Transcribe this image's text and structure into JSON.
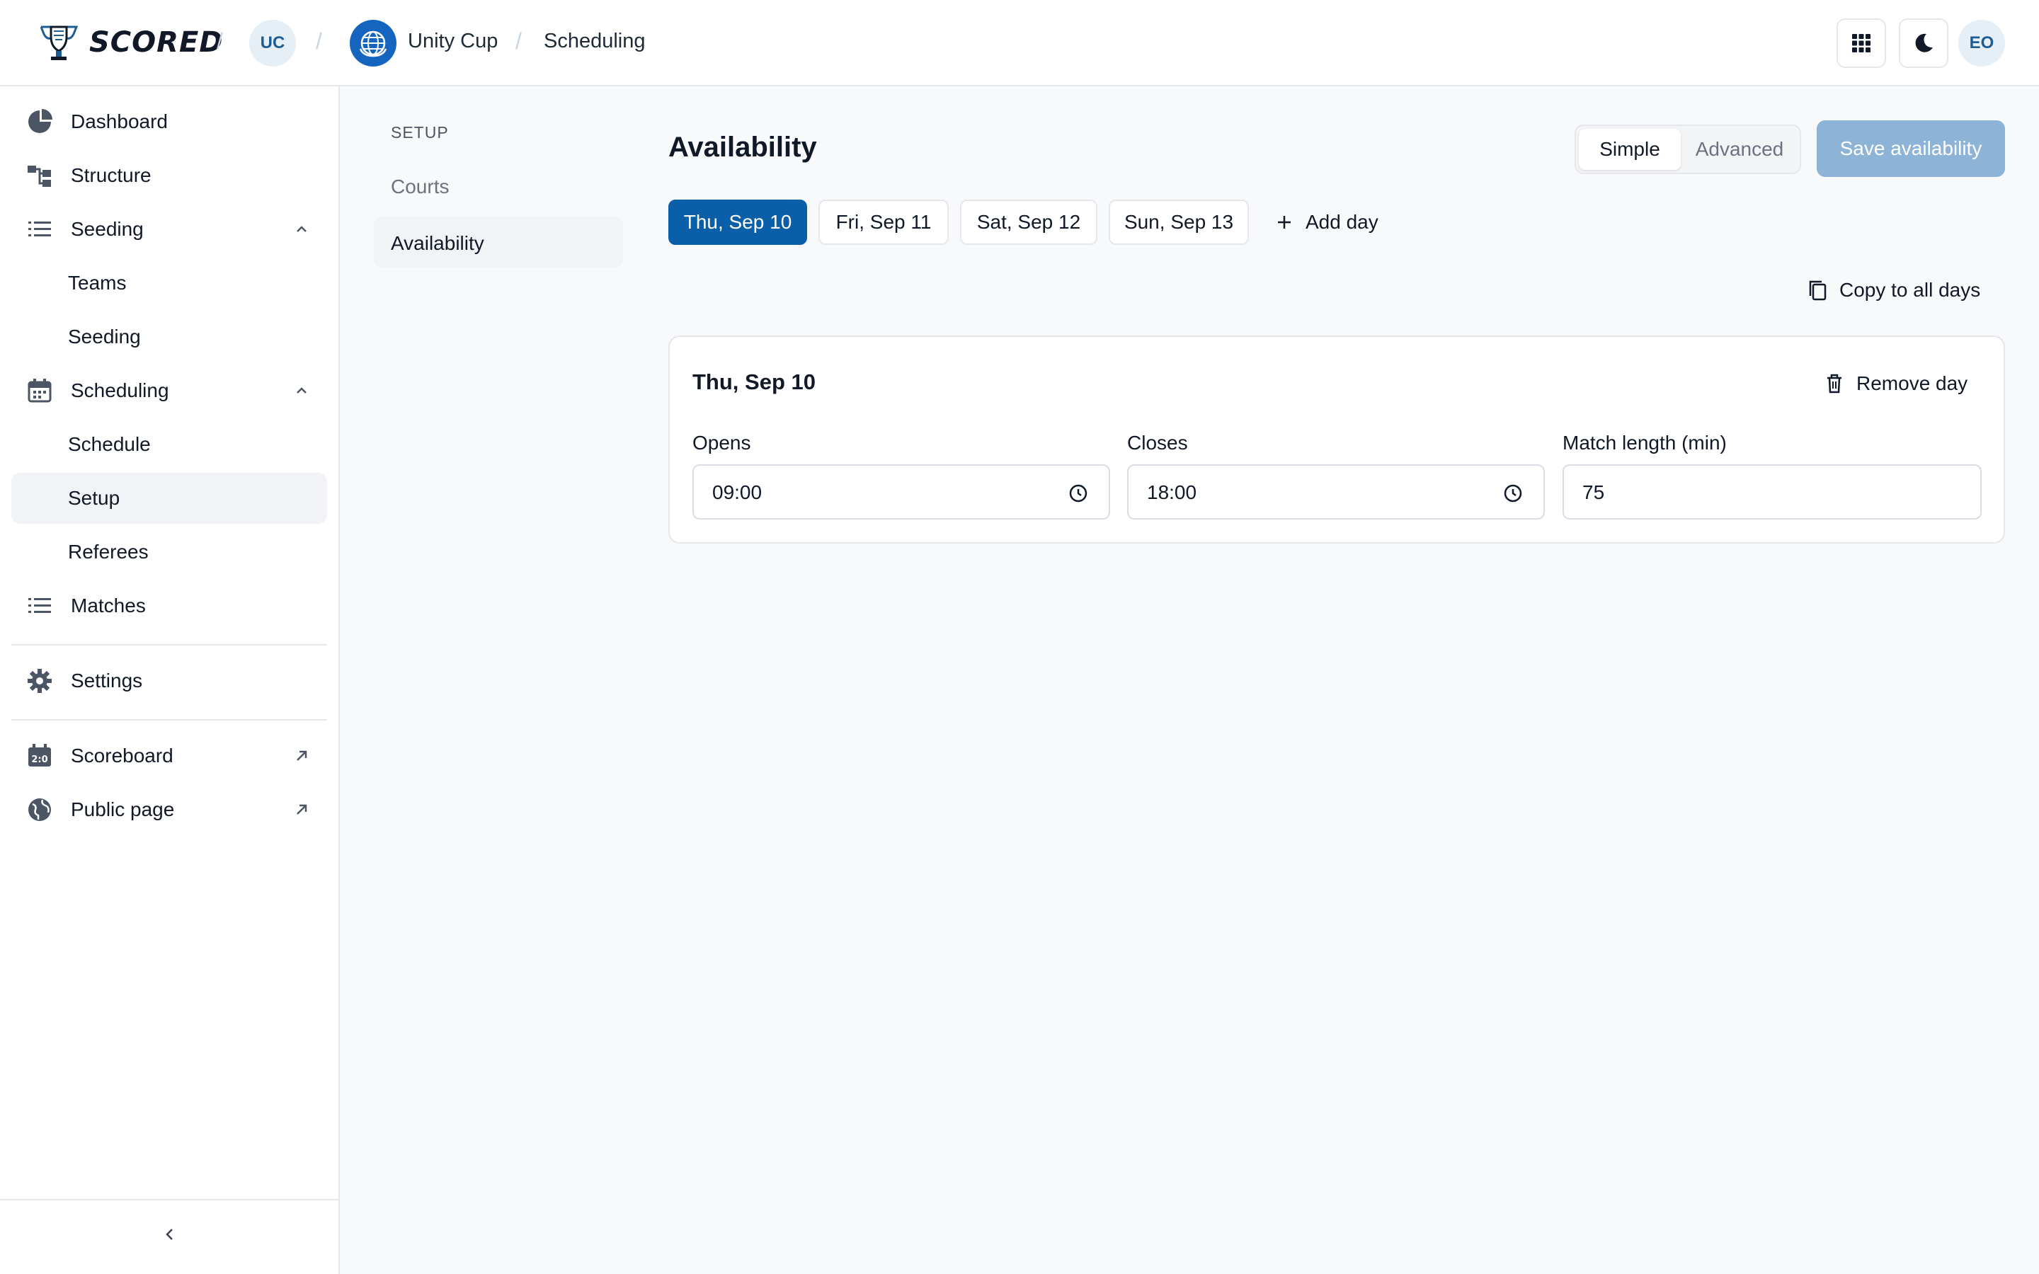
{
  "app": {
    "brand": "SCORED"
  },
  "header": {
    "org_initials": "UC",
    "tournament_name": "Unity Cup",
    "section": "Scheduling",
    "user_initials": "EO",
    "apps_icon": "grid-icon",
    "theme_icon": "moon-icon"
  },
  "sidebar": {
    "items": [
      {
        "label": "Dashboard",
        "icon": "pie-chart-icon"
      },
      {
        "label": "Structure",
        "icon": "hierarchy-icon"
      },
      {
        "label": "Seeding",
        "icon": "list-icon",
        "expanded": true
      },
      {
        "label": "Teams"
      },
      {
        "label": "Seeding"
      },
      {
        "label": "Scheduling",
        "icon": "calendar-icon",
        "expanded": true
      },
      {
        "label": "Schedule"
      },
      {
        "label": "Setup",
        "active": true
      },
      {
        "label": "Referees"
      },
      {
        "label": "Matches",
        "icon": "list-icon"
      },
      {
        "label": "Settings",
        "icon": "gear-icon"
      },
      {
        "label": "Scoreboard",
        "icon": "scoreboard-icon",
        "external": true
      },
      {
        "label": "Public page",
        "icon": "globe-icon",
        "external": true
      }
    ]
  },
  "subnav": {
    "title": "SETUP",
    "items": [
      {
        "label": "Courts"
      },
      {
        "label": "Availability",
        "active": true
      }
    ]
  },
  "main": {
    "title": "Availability",
    "mode_options": [
      "Simple",
      "Advanced"
    ],
    "selected_mode": "Simple",
    "save_label": "Save availability",
    "days": [
      "Thu, Sep 10",
      "Fri, Sep 11",
      "Sat, Sep 12",
      "Sun, Sep 13"
    ],
    "selected_day": "Thu, Sep 10",
    "add_day_label": "Add day",
    "copy_all_label": "Copy to all days",
    "card": {
      "title": "Thu, Sep 10",
      "remove_label": "Remove day",
      "opens_label": "Opens",
      "opens_value": "09:00",
      "closes_label": "Closes",
      "closes_value": "18:00",
      "match_length_label": "Match length (min)",
      "match_length_value": "75"
    }
  },
  "colors": {
    "primary": "#0b5ea8",
    "save_disabled": "#8db3d6",
    "tournament_logo": "#1565c0",
    "avatar_bg": "#e6eef6"
  }
}
